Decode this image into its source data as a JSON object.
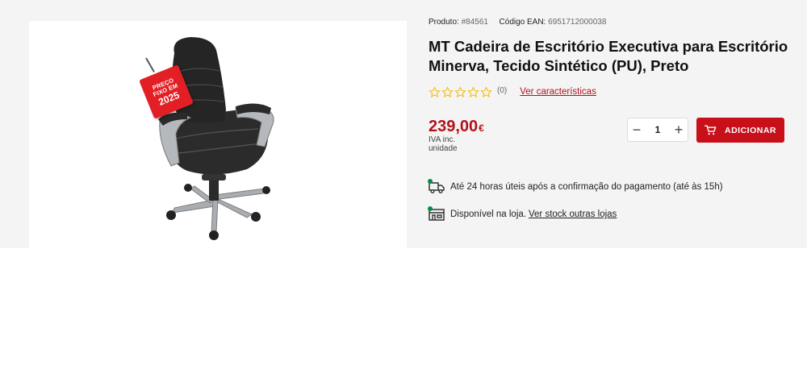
{
  "product": {
    "id_label": "Produto:",
    "id_value": "#84561",
    "ean_label": "Código EAN:",
    "ean_value": "6951712000038",
    "title_line1": "MT Cadeira de Escritório Executiva para Escritório",
    "title_line2": "Minerva, Tecido Sintético (PU), Preto",
    "rating_count": "(0)",
    "stars": 0,
    "view_features_link": "Ver características"
  },
  "tag": {
    "line1": "PREÇO",
    "line2": "FIXO EM",
    "line3": "2025"
  },
  "price": {
    "value": "239,00",
    "currency": "€",
    "tax_note": "IVA inc.",
    "unit": "unidade"
  },
  "quantity": {
    "minus": "−",
    "value": "1",
    "plus": "+"
  },
  "add_button": {
    "label": "ADICIONAR"
  },
  "shipping": {
    "text": "Até 24 horas úteis após a confirmação do pagamento (até às 15h)"
  },
  "stock": {
    "text": "Disponível na loja.",
    "link": "Ver stock outras lojas"
  },
  "colors": {
    "accent": "#c8101a",
    "price": "#b3121b",
    "available": "#0a8a4a",
    "star": "#f5b800"
  }
}
